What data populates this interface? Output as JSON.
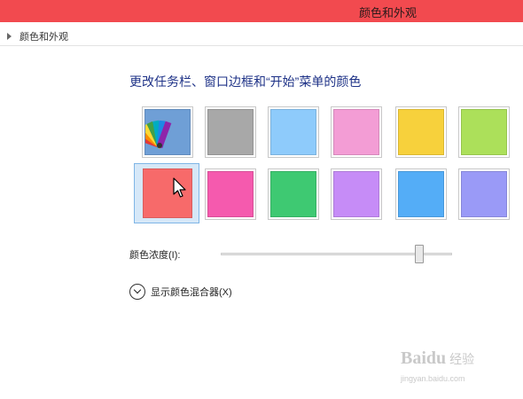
{
  "window": {
    "title": "颜色和外观"
  },
  "breadcrumb": {
    "item": "颜色和外观"
  },
  "heading": "更改任务栏、窗口边框和“开始”菜单的颜色",
  "swatches": [
    {
      "name": "automatic",
      "color": "#6f9fd6",
      "selected": false
    },
    {
      "name": "gray",
      "color": "#a8a8a8",
      "selected": false
    },
    {
      "name": "sky-blue",
      "color": "#8ecbfb",
      "selected": false
    },
    {
      "name": "pink",
      "color": "#f39dd5",
      "selected": false
    },
    {
      "name": "yellow",
      "color": "#f7d13c",
      "selected": false
    },
    {
      "name": "lime",
      "color": "#ace05a",
      "selected": false
    },
    {
      "name": "red",
      "color": "#f76a6a",
      "selected": true
    },
    {
      "name": "magenta",
      "color": "#f55aae",
      "selected": false
    },
    {
      "name": "green",
      "color": "#3ec972",
      "selected": false
    },
    {
      "name": "violet",
      "color": "#c68cf7",
      "selected": false
    },
    {
      "name": "blue",
      "color": "#54adf7",
      "selected": false
    },
    {
      "name": "periwinkle",
      "color": "#9a9af7",
      "selected": false
    }
  ],
  "intensity": {
    "label": "颜色浓度(I):",
    "value_fraction": 0.86
  },
  "mixer": {
    "label": "显示颜色混合器(X)",
    "icon": "chevron-down-icon"
  },
  "watermark": {
    "brand": "Bai",
    "brand_suffix": "du",
    "brand_cn": "经验",
    "url": "jingyan.baidu.com"
  },
  "icons": {
    "automatic": "color-fan-icon",
    "pointer": "mouse-pointer-icon"
  }
}
